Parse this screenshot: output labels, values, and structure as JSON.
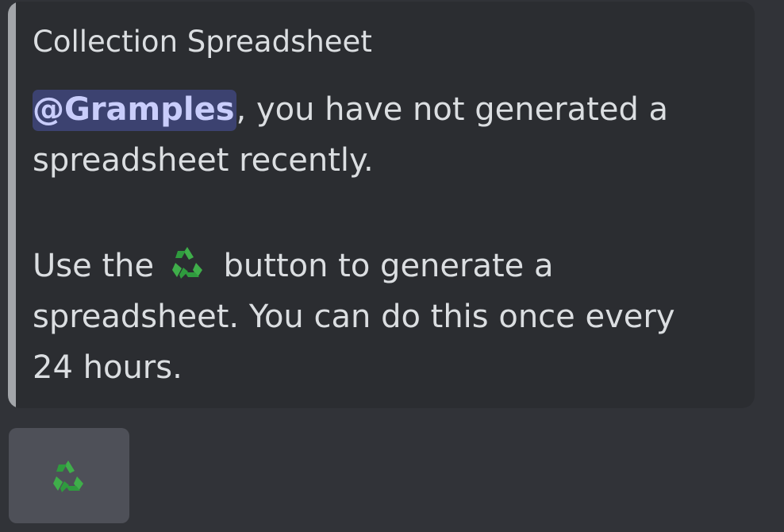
{
  "embed": {
    "title": "Collection Spreadsheet",
    "accent_color": "#a3a6aa",
    "mention": "@Gramples",
    "line1_rest": ", you have not generated a",
    "line2": "spreadsheet recently.",
    "line3_before_icon": "Use the",
    "line3_icon": "recycle-icon",
    "line3_after_icon": "button to generate a",
    "line4": "spreadsheet. You can do this once every",
    "line5": "24 hours."
  },
  "action_button": {
    "icon": "recycle-icon",
    "icon_color": "#3fae4a"
  },
  "colors": {
    "background": "#313338",
    "embed_background": "#2b2d31",
    "mention_background": "#3c4270",
    "mention_text": "#c9cdfb",
    "button_background": "#4e5058"
  }
}
